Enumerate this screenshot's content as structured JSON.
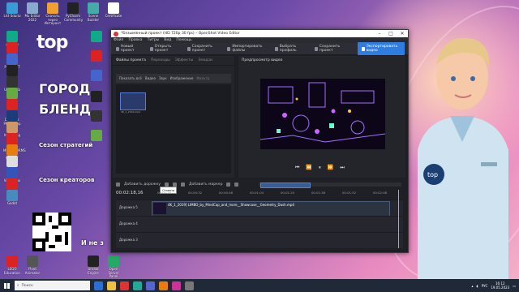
{
  "desktop": {
    "icons": [
      {
        "label": "Lrtt Sdurio",
        "color": "#3a9bd5"
      },
      {
        "label": "Mu Editor 2022",
        "color": "#8ac"
      },
      {
        "label": "Скачать через Интернет",
        "color": "#f0a030"
      },
      {
        "label": "PyCharm Community",
        "color": "#222"
      },
      {
        "label": "Scene Builder",
        "color": "#4aa"
      },
      {
        "label": "Certificate",
        "color": "#fff"
      },
      {
        "label": "Arduino IDE",
        "color": "#1a8"
      },
      {
        "label": "LEGO",
        "color": "#d22"
      },
      {
        "label": "Paint.NET",
        "color": "#46c"
      },
      {
        "label": "EPIC",
        "color": "#222"
      },
      {
        "label": "Unity Hub",
        "color": "#333"
      },
      {
        "label": "Kodu",
        "color": "#6a4"
      },
      {
        "label": "LEGO Digital Designer",
        "color": "#d22"
      },
      {
        "label": "Photoshop",
        "color": "#1a3c7a"
      },
      {
        "label": "Image.jpg",
        "color": "#c96"
      },
      {
        "label": "LEGO MINDSTORMS",
        "color": "#d22"
      },
      {
        "label": "Blender",
        "color": "#e87d0d"
      },
      {
        "label": "Roblox Studio",
        "color": "#ddd"
      },
      {
        "label": "VirtualBox",
        "color": "#35b"
      },
      {
        "label": "Opera",
        "color": "#d22"
      },
      {
        "label": "Godot",
        "color": "#478cbf"
      }
    ],
    "banner_text": "top",
    "slogan_lines": [
      "ГОРОД",
      "БЛЕНД",
      "Сезон стратегий",
      "Сезон креаторов"
    ],
    "bottom_slogan": "И не з",
    "bottom_icons": [
      {
        "label": "LEGO Education",
        "color": "#d22"
      },
      {
        "label": "Pivot Animator",
        "color": "#555"
      },
      {
        "label": "Unreal Engine",
        "color": "#222"
      },
      {
        "label": "Open Server Panel",
        "color": "#2a6"
      }
    ]
  },
  "window": {
    "title": "*Безымянный проект (HD 720p 30 fps) – OpenShot Video Editor",
    "menu": [
      "Файл",
      "Правка",
      "Титры",
      "Вид",
      "Помощь"
    ],
    "toolbar": [
      {
        "label": "Новый проект"
      },
      {
        "label": "Открыть проект"
      },
      {
        "label": "Сохранить проект"
      },
      {
        "label": "Импортировать файлы"
      },
      {
        "label": "Выбрать профиль"
      }
    ],
    "toolbar_right": {
      "save_label": "Сохранить проект",
      "export_label": "Экспортировать видео"
    },
    "left_tabs": [
      "Файлы проекта",
      "Переходы",
      "Эффекты",
      "Эмодзи"
    ],
    "filters": [
      "Показать всё",
      "Видео",
      "Звук",
      "Изображение",
      "Фильтр"
    ],
    "thumb_label": "4K_1_2019.mp4",
    "preview_title": "Предпросмотр видео",
    "timeline": {
      "add_track_label": "Добавить дорожку",
      "add_marker_label": "Добавить маркер",
      "tooltip": "Отмена",
      "timecode": "00:02:18,16",
      "ruler": [
        "00:00:16",
        "00:00:32",
        "00:00:48",
        "00:01:04",
        "00:01:20",
        "00:01:36",
        "00:01:52",
        "00:02:08"
      ],
      "tracks": [
        {
          "name": "Дорожка 5",
          "clip": "4K_1_2019.mp4"
        },
        {
          "name": "Дорожка 4",
          "clip": ""
        },
        {
          "name": "Дорожка 3",
          "clip": ""
        }
      ],
      "clip_full_name": "4K_1_2019] LIMBO_by_MindCap_and_more__Showcase__Geometry_Dash.mp4"
    }
  },
  "taskbar": {
    "search_placeholder": "Поиск",
    "time": "16:12",
    "date": "19.05.2023",
    "lang": "РУС",
    "icon_colors": [
      "#2b6fd6",
      "#f0c040",
      "#d33",
      "#2a9",
      "#5566cc",
      "#e87d0d",
      "#cc3399",
      "#777"
    ]
  },
  "colors": {
    "accent": "#2f7de1",
    "playhead": "#e6a23c"
  }
}
